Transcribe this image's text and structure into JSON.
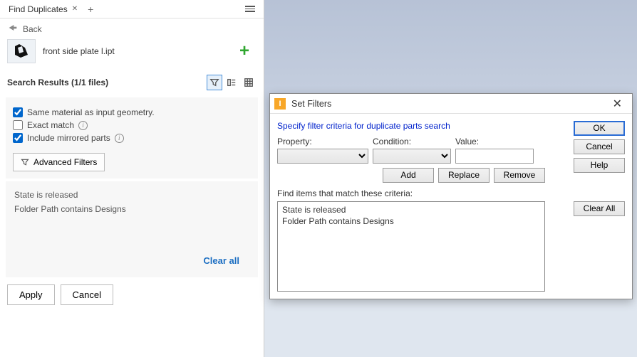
{
  "tab": {
    "title": "Find Duplicates"
  },
  "back": {
    "label": "Back"
  },
  "file": {
    "name": "front side plate l.ipt"
  },
  "results": {
    "title": "Search Results (1/1 files)"
  },
  "checks": {
    "same_material": "Same material as input geometry.",
    "exact_match": "Exact match",
    "include_mirrored": "Include mirrored parts"
  },
  "adv_filters_btn": "Advanced Filters",
  "criteria": {
    "line1": "State is released",
    "line2": "Folder Path contains Designs"
  },
  "clear_all_link": "Clear all",
  "footer": {
    "apply": "Apply",
    "cancel": "Cancel"
  },
  "dialog": {
    "title": "Set Filters",
    "instruction": "Specify filter criteria for duplicate parts search",
    "labels": {
      "property": "Property:",
      "condition": "Condition:",
      "value": "Value:"
    },
    "buttons": {
      "add": "Add",
      "replace": "Replace",
      "remove": "Remove",
      "ok": "OK",
      "cancel": "Cancel",
      "help": "Help",
      "clear_all": "Clear All"
    },
    "find_label": "Find items that match these criteria:",
    "items": {
      "l1": "State is released",
      "l2": "Folder Path contains Designs"
    }
  }
}
